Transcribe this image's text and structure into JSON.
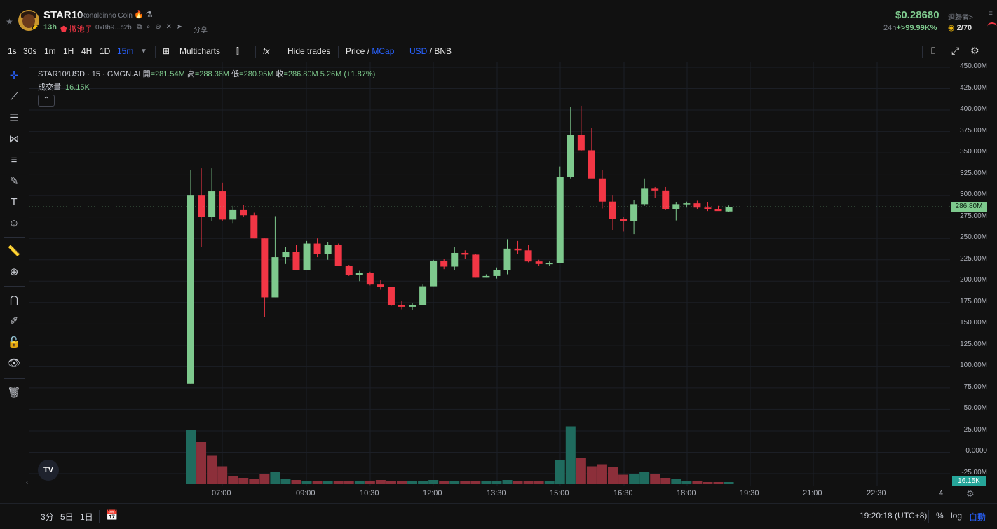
{
  "header": {
    "symbol": "STAR10",
    "name": "Ronaldinho Coin",
    "age": "13h",
    "rug_label": "撤池子",
    "address": "0x8b9...c2b",
    "share": "分享",
    "price": "$0.28680",
    "holders_label": "迴歸者>",
    "change_prefix": "24h",
    "change": "+>99.99K%",
    "ratio": "2/70"
  },
  "toolbar": {
    "intervals": [
      "1s",
      "30s",
      "1m",
      "1H",
      "4H",
      "1D",
      "15m"
    ],
    "active_interval": "15m",
    "multicharts": "Multicharts",
    "fx": "fx",
    "hide_trades": "Hide trades",
    "price_label": "Price",
    "slash1": "/",
    "mcap_label": "MCap",
    "usd_label": "USD",
    "slash2": "/",
    "bnb_label": "BNB"
  },
  "legend": {
    "pair": "STAR10/USD · 15 · GMGN.AI",
    "open_label": "開",
    "open": "=281.54M",
    "high_label": "高",
    "high": "=288.36M",
    "low_label": "低",
    "low": "=280.95M",
    "close_label": "收",
    "close": "=286.80M",
    "change": "5.26M (+1.87%)",
    "volume_label": "成交量",
    "volume": "16.15K"
  },
  "axis": {
    "y_ticks": [
      "450.00M",
      "425.00M",
      "400.00M",
      "375.00M",
      "350.00M",
      "325.00M",
      "300.00M",
      "275.00M",
      "250.00M",
      "225.00M",
      "200.00M",
      "175.00M",
      "150.00M",
      "125.00M",
      "100.00M",
      "75.00M",
      "50.00M",
      "25.00M",
      "0.0000",
      "-25.00M"
    ],
    "x_ticks": [
      "07:00",
      "09:00",
      "10:30",
      "12:00",
      "13:30",
      "15:00",
      "16:30",
      "18:00",
      "19:30",
      "21:00",
      "22:30"
    ],
    "current_price": "286.80M",
    "current_volume": "16.15K",
    "right_edge": "4"
  },
  "bottom": {
    "ranges": [
      "3分",
      "5日",
      "1日"
    ],
    "clock": "19:20:18 (UTC+8)",
    "percent": "%",
    "log": "log",
    "auto": "自動"
  },
  "colors": {
    "up": "#7ec98d",
    "down": "#f23645",
    "bg": "#111111",
    "accent": "#2962ff",
    "vol_up": "#26a69a",
    "vol_down": "#ef5350"
  },
  "chart_data": {
    "type": "candlestick",
    "ylim": [
      -25,
      450
    ],
    "unit": "M",
    "candles": [
      {
        "o": 80,
        "h": 330,
        "l": 80,
        "c": 300
      },
      {
        "o": 300,
        "h": 332,
        "l": 240,
        "c": 275
      },
      {
        "o": 275,
        "h": 332,
        "l": 270,
        "c": 305
      },
      {
        "o": 305,
        "h": 315,
        "l": 270,
        "c": 272
      },
      {
        "o": 272,
        "h": 288,
        "l": 268,
        "c": 283
      },
      {
        "o": 283,
        "h": 289,
        "l": 275,
        "c": 277
      },
      {
        "o": 277,
        "h": 280,
        "l": 250,
        "c": 250
      },
      {
        "o": 250,
        "h": 250,
        "l": 158,
        "c": 181
      },
      {
        "o": 181,
        "h": 276,
        "l": 181,
        "c": 228
      },
      {
        "o": 228,
        "h": 240,
        "l": 220,
        "c": 234
      },
      {
        "o": 234,
        "h": 242,
        "l": 213,
        "c": 213
      },
      {
        "o": 213,
        "h": 247,
        "l": 213,
        "c": 244
      },
      {
        "o": 244,
        "h": 250,
        "l": 228,
        "c": 232
      },
      {
        "o": 232,
        "h": 246,
        "l": 225,
        "c": 242
      },
      {
        "o": 242,
        "h": 244,
        "l": 218,
        "c": 218
      },
      {
        "o": 218,
        "h": 219,
        "l": 206,
        "c": 207
      },
      {
        "o": 207,
        "h": 212,
        "l": 200,
        "c": 210
      },
      {
        "o": 210,
        "h": 211,
        "l": 195,
        "c": 196
      },
      {
        "o": 196,
        "h": 201,
        "l": 190,
        "c": 193
      },
      {
        "o": 193,
        "h": 193,
        "l": 171,
        "c": 172
      },
      {
        "o": 172,
        "h": 177,
        "l": 167,
        "c": 170
      },
      {
        "o": 170,
        "h": 174,
        "l": 166,
        "c": 172
      },
      {
        "o": 172,
        "h": 196,
        "l": 172,
        "c": 194
      },
      {
        "o": 194,
        "h": 225,
        "l": 194,
        "c": 224
      },
      {
        "o": 224,
        "h": 226,
        "l": 214,
        "c": 217
      },
      {
        "o": 217,
        "h": 240,
        "l": 213,
        "c": 233
      },
      {
        "o": 233,
        "h": 236,
        "l": 226,
        "c": 231
      },
      {
        "o": 231,
        "h": 232,
        "l": 204,
        "c": 204
      },
      {
        "o": 204,
        "h": 208,
        "l": 204,
        "c": 206
      },
      {
        "o": 206,
        "h": 216,
        "l": 203,
        "c": 213
      },
      {
        "o": 213,
        "h": 249,
        "l": 208,
        "c": 238
      },
      {
        "o": 238,
        "h": 247,
        "l": 232,
        "c": 236
      },
      {
        "o": 236,
        "h": 242,
        "l": 222,
        "c": 223
      },
      {
        "o": 223,
        "h": 225,
        "l": 218,
        "c": 220
      },
      {
        "o": 220,
        "h": 223,
        "l": 218,
        "c": 221
      },
      {
        "o": 221,
        "h": 334,
        "l": 221,
        "c": 322
      },
      {
        "o": 322,
        "h": 404,
        "l": 320,
        "c": 371
      },
      {
        "o": 371,
        "h": 405,
        "l": 352,
        "c": 353
      },
      {
        "o": 353,
        "h": 379,
        "l": 322,
        "c": 320
      },
      {
        "o": 320,
        "h": 330,
        "l": 285,
        "c": 293
      },
      {
        "o": 293,
        "h": 300,
        "l": 260,
        "c": 273
      },
      {
        "o": 273,
        "h": 275,
        "l": 258,
        "c": 270
      },
      {
        "o": 270,
        "h": 295,
        "l": 255,
        "c": 290
      },
      {
        "o": 290,
        "h": 320,
        "l": 288,
        "c": 308
      },
      {
        "o": 308,
        "h": 310,
        "l": 297,
        "c": 306
      },
      {
        "o": 306,
        "h": 310,
        "l": 283,
        "c": 284
      },
      {
        "o": 284,
        "h": 292,
        "l": 271,
        "c": 290
      },
      {
        "o": 290,
        "h": 293,
        "l": 286,
        "c": 291
      },
      {
        "o": 291,
        "h": 294,
        "l": 284,
        "c": 286
      },
      {
        "o": 286,
        "h": 292,
        "l": 282,
        "c": 284
      },
      {
        "o": 284,
        "h": 288,
        "l": 283,
        "c": 282
      },
      {
        "o": 281.5,
        "h": 288.4,
        "l": 281,
        "c": 286.8
      }
    ],
    "volume_levels": [
      0.52,
      0.4,
      0.27,
      0.17,
      0.08,
      0.06,
      0.05,
      0.1,
      0.12,
      0.05,
      0.04,
      0.03,
      0.03,
      0.03,
      0.03,
      0.03,
      0.03,
      0.03,
      0.04,
      0.03,
      0.03,
      0.03,
      0.03,
      0.04,
      0.03,
      0.03,
      0.03,
      0.03,
      0.03,
      0.03,
      0.04,
      0.03,
      0.03,
      0.03,
      0.03,
      0.23,
      0.55,
      0.25,
      0.17,
      0.19,
      0.16,
      0.09,
      0.1,
      0.12,
      0.1,
      0.06,
      0.05,
      0.03,
      0.03,
      0.02,
      0.02,
      0.02
    ],
    "volume_up": [
      true,
      false,
      false,
      false,
      false,
      false,
      false,
      false,
      true,
      true,
      false,
      true,
      false,
      true,
      false,
      false,
      true,
      false,
      false,
      false,
      false,
      true,
      true,
      true,
      false,
      true,
      false,
      false,
      true,
      true,
      true,
      false,
      false,
      false,
      true,
      true,
      true,
      false,
      false,
      false,
      false,
      false,
      true,
      true,
      false,
      false,
      true,
      true,
      false,
      false,
      false,
      true
    ]
  }
}
